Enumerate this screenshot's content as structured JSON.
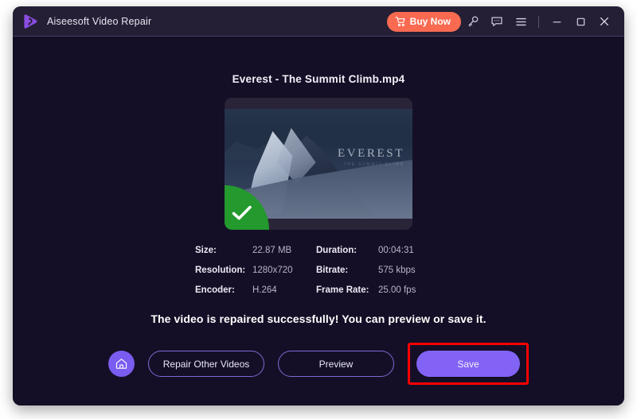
{
  "window": {
    "app_title": "Aiseesoft Video Repair",
    "logo_icon": "play-logo-icon",
    "accent_purple": "#7b5cf0",
    "buy_now_color": "#f96a51",
    "success_green": "#23992e",
    "highlight_red": "#ff0000"
  },
  "titlebar": {
    "buy_now_label": "Buy Now",
    "cart_icon": "shopping-cart-icon",
    "key_icon": "key-icon",
    "feedback_icon": "chat-bubble-icon",
    "menu_icon": "hamburger-menu-icon",
    "minimize_icon": "minimize-icon",
    "maximize_icon": "maximize-icon",
    "close_icon": "close-icon"
  },
  "main": {
    "file_name": "Everest - The Summit Climb.mp4",
    "thumbnail": {
      "watermark_title": "EVEREST",
      "watermark_subtitle": "THE SUMMIT CLIMB",
      "badge_icon": "green-check-badge-icon"
    },
    "metadata": [
      {
        "label": "Size:",
        "value": "22.87 MB"
      },
      {
        "label": "Duration:",
        "value": "00:04:31"
      },
      {
        "label": "Resolution:",
        "value": "1280x720"
      },
      {
        "label": "Bitrate:",
        "value": "575 kbps"
      },
      {
        "label": "Encoder:",
        "value": "H.264"
      },
      {
        "label": "Frame Rate:",
        "value": "25.00 fps"
      }
    ],
    "status_text": "The video is repaired successfully! You can preview or save it."
  },
  "actions": {
    "home_icon": "home-icon",
    "repair_other_label": "Repair Other Videos",
    "preview_label": "Preview",
    "save_label": "Save"
  }
}
